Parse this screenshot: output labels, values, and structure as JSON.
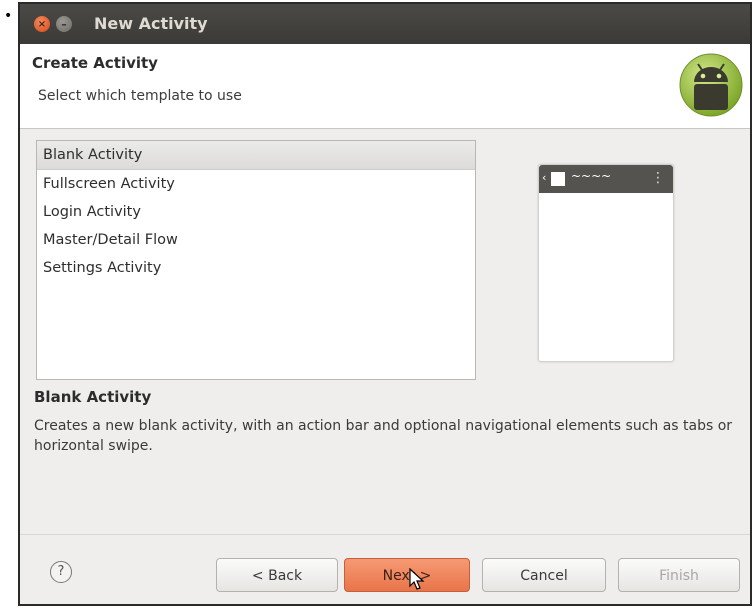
{
  "window": {
    "title": "New Activity"
  },
  "header": {
    "title": "Create Activity",
    "subtitle": "Select which template to use"
  },
  "templates": {
    "selected_index": 0,
    "items": [
      {
        "label": "Blank Activity"
      },
      {
        "label": "Fullscreen Activity"
      },
      {
        "label": "Login Activity"
      },
      {
        "label": "Master/Detail Flow"
      },
      {
        "label": "Settings Activity"
      }
    ]
  },
  "description": {
    "title": "Blank Activity",
    "text": "Creates a new blank activity, with an action bar and optional navigational elements such as tabs or horizontal swipe."
  },
  "buttons": {
    "help": "?",
    "back": "< Back",
    "next": "Next >",
    "cancel": "Cancel",
    "finish": "Finish"
  },
  "colors": {
    "titlebar": "#3f3e3a",
    "next_button": "#ef8458",
    "android_green": "#a4c639"
  },
  "icons": {
    "close": "close-icon",
    "minimize": "minimize-icon",
    "android": "android-logo-icon",
    "help": "help-icon"
  }
}
